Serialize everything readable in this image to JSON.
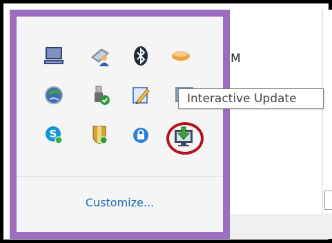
{
  "tray": {
    "customize_label": "Customize...",
    "icons": [
      {
        "name": "keyboard-device-icon"
      },
      {
        "name": "network-user-icon"
      },
      {
        "name": "bluetooth-icon"
      },
      {
        "name": "pill-capsule-icon"
      },
      {
        "name": "refresh-globe-icon"
      },
      {
        "name": "usb-safe-remove-icon"
      },
      {
        "name": "notepad-pencil-icon"
      },
      {
        "name": "monitor-partial-icon"
      },
      {
        "name": "skype-icon"
      },
      {
        "name": "security-shield-icon"
      },
      {
        "name": "vpn-lock-icon"
      },
      {
        "name": "interactive-update-icon"
      }
    ]
  },
  "tooltip": {
    "text": "Interactive Update"
  },
  "background": {
    "glyph": "M"
  },
  "colors": {
    "tray_border": "#9b6ec1",
    "highlight": "#b0141d",
    "link": "#1a6bb8"
  }
}
